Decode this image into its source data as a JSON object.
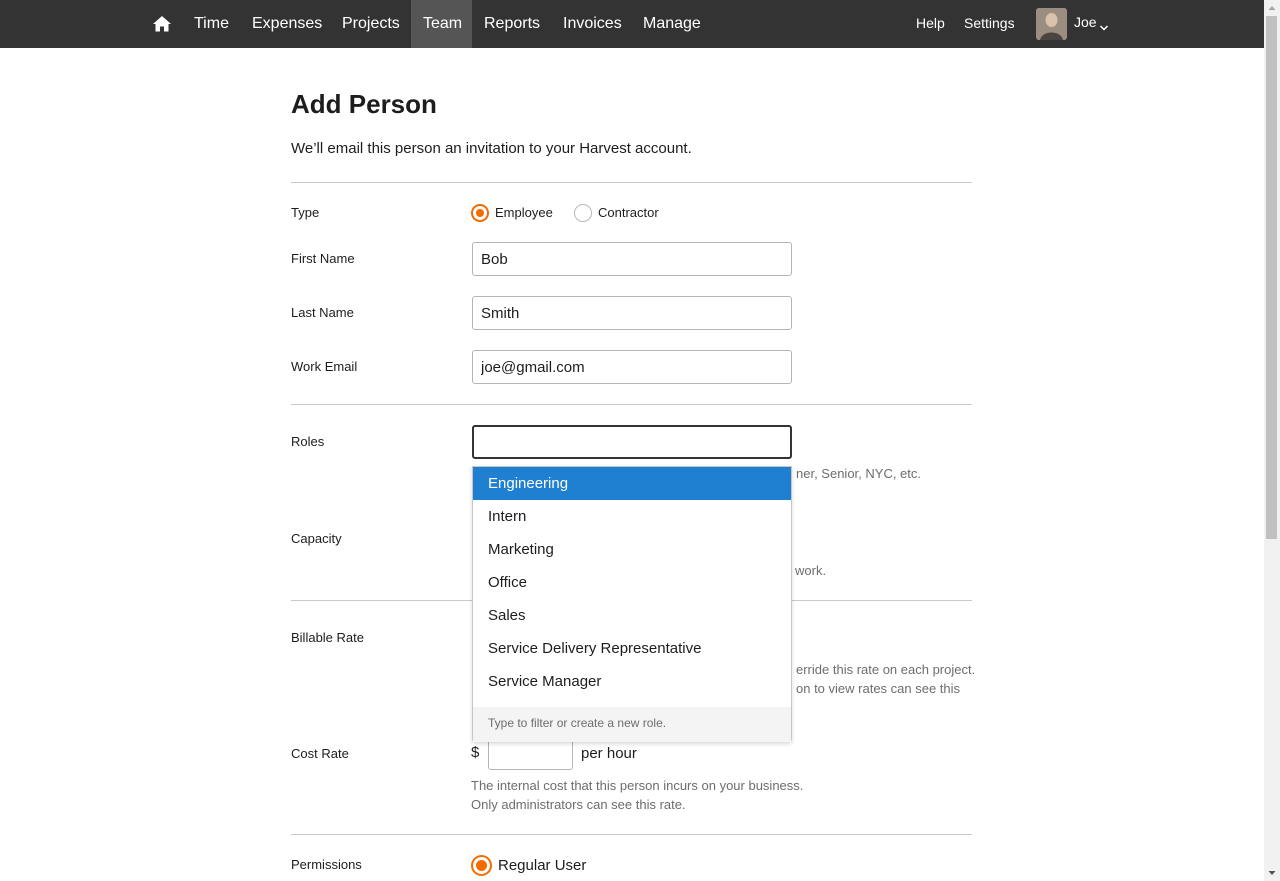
{
  "nav": {
    "items": [
      {
        "label": "Time"
      },
      {
        "label": "Expenses"
      },
      {
        "label": "Projects"
      },
      {
        "label": "Team"
      },
      {
        "label": "Reports"
      },
      {
        "label": "Invoices"
      },
      {
        "label": "Manage"
      }
    ],
    "active": "Team",
    "help": "Help",
    "settings": "Settings",
    "user": "Joe"
  },
  "page": {
    "title": "Add Person",
    "subtitle": "We’ll email this person an invitation to your Harvest account."
  },
  "form": {
    "type_label": "Type",
    "type_options": [
      "Employee",
      "Contractor"
    ],
    "type_selected": "Employee",
    "first_name_label": "First Name",
    "first_name_value": "Bob",
    "last_name_label": "Last Name",
    "last_name_value": "Smith",
    "email_label": "Work Email",
    "email_value": "joe@gmail.com",
    "roles_label": "Roles",
    "roles_value": "",
    "roles_help_partial": "ner, Senior, NYC, etc.",
    "capacity_label": "Capacity",
    "capacity_help_partial": "work.",
    "billable_label": "Billable Rate",
    "billable_help_line1_partial": "erride this rate on each project.",
    "billable_help_line2_partial": "on to view rates can see this",
    "cost_label": "Cost Rate",
    "cost_currency": "$",
    "cost_unit": "per hour",
    "cost_help_line1": "The internal cost that this person incurs on your business.",
    "cost_help_line2": "Only administrators can see this rate.",
    "permissions_label": "Permissions",
    "permissions_selected": "Regular User"
  },
  "roles_dropdown": {
    "items": [
      "Engineering",
      "Intern",
      "Marketing",
      "Office",
      "Sales",
      "Service Delivery Representative",
      "Service Manager"
    ],
    "highlighted": "Engineering",
    "footer": "Type to filter or create a new role."
  },
  "colors": {
    "nav_bg": "#333333",
    "accent": "#f36c00",
    "highlight": "#1f7fd1"
  }
}
